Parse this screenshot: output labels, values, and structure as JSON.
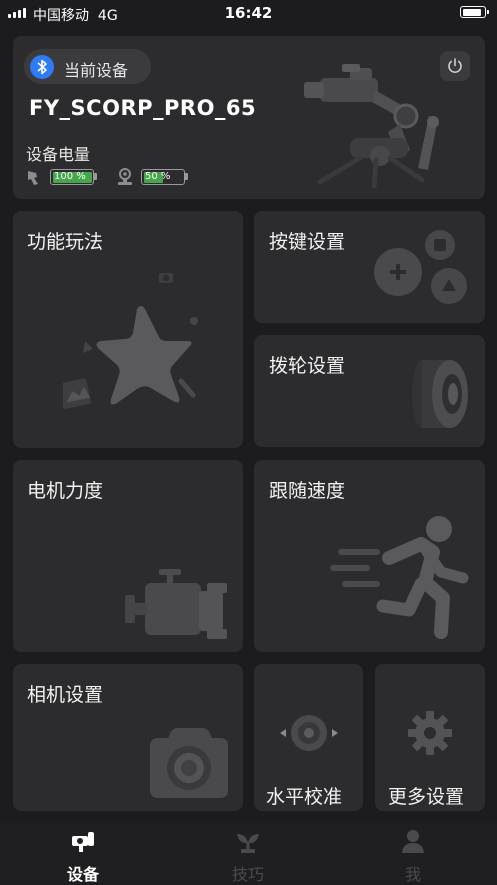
{
  "status_bar": {
    "carrier": "中国移动",
    "network": "4G",
    "time": "16:42",
    "battery_level": 0.9
  },
  "device_card": {
    "chip_label": "当前设备",
    "device_name": "FY_SCORP_PRO_65",
    "battery_title": "设备电量",
    "gimbal_battery": {
      "text": "100 %",
      "level": 1.0
    },
    "camera_battery": {
      "text": "50 %",
      "level": 0.5
    }
  },
  "tiles": {
    "features": "功能玩法",
    "buttons": "按键设置",
    "dial": "拨轮设置",
    "motor": "电机力度",
    "follow": "跟随速度",
    "camera": "相机设置",
    "horizontal": "水平校准",
    "more": "更多设置"
  },
  "tabs": [
    {
      "label": "设备",
      "active": true
    },
    {
      "label": "技巧",
      "active": false
    },
    {
      "label": "我",
      "active": false
    }
  ],
  "colors": {
    "accent": "#2f7bf5",
    "battery_green": "#45a64b",
    "card": "#2c2c2e",
    "background": "#1c1c1e"
  }
}
